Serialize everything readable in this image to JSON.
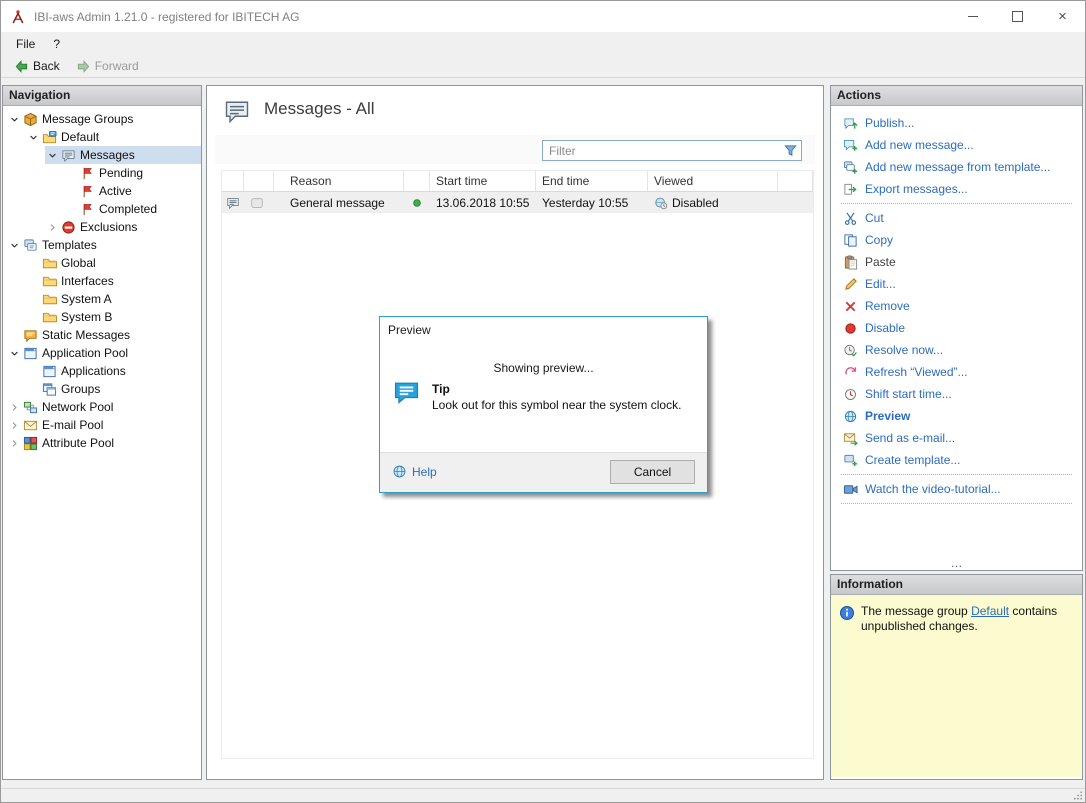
{
  "window": {
    "title": "IBI-aws Admin 1.21.0 - registered for IBITECH AG"
  },
  "menu": {
    "items": [
      {
        "label": "File"
      },
      {
        "label": "?"
      }
    ]
  },
  "toolbar": {
    "back_label": "Back",
    "forward_label": "Forward"
  },
  "navigation": {
    "header": "Navigation",
    "tree": [
      {
        "label": "Message Groups",
        "level": 0,
        "expander": "down",
        "icon": "message-groups-cube"
      },
      {
        "label": "Default",
        "level": 1,
        "expander": "down",
        "icon": "folder-message"
      },
      {
        "label": "Messages",
        "level": 2,
        "expander": "down",
        "icon": "message-bubble",
        "selected": true
      },
      {
        "label": "Pending",
        "level": 3,
        "expander": null,
        "icon": "flag-red"
      },
      {
        "label": "Active",
        "level": 3,
        "expander": null,
        "icon": "flag-red"
      },
      {
        "label": "Completed",
        "level": 3,
        "expander": null,
        "icon": "flag-red"
      },
      {
        "label": "Exclusions",
        "level": 2,
        "expander": "right",
        "icon": "no-entry"
      },
      {
        "label": "Templates",
        "level": 0,
        "expander": "down",
        "icon": "templates-stack"
      },
      {
        "label": "Global",
        "level": 1,
        "expander": null,
        "icon": "folder"
      },
      {
        "label": "Interfaces",
        "level": 1,
        "expander": null,
        "icon": "folder"
      },
      {
        "label": "System A",
        "level": 1,
        "expander": null,
        "icon": "folder"
      },
      {
        "label": "System B",
        "level": 1,
        "expander": null,
        "icon": "folder"
      },
      {
        "label": "Static Messages",
        "level": 0,
        "expander": null,
        "icon": "static-message"
      },
      {
        "label": "Application Pool",
        "level": 0,
        "expander": "down",
        "icon": "app-window"
      },
      {
        "label": "Applications",
        "level": 1,
        "expander": null,
        "icon": "app-window"
      },
      {
        "label": "Groups",
        "level": 1,
        "expander": null,
        "icon": "groups"
      },
      {
        "label": "Network Pool",
        "level": 0,
        "expander": "right",
        "icon": "network"
      },
      {
        "label": "E-mail Pool",
        "level": 0,
        "expander": "right",
        "icon": "envelope"
      },
      {
        "label": "Attribute Pool",
        "level": 0,
        "expander": "right",
        "icon": "attribute-grid"
      }
    ]
  },
  "content": {
    "title": "Messages - All",
    "filter_placeholder": "Filter",
    "table": {
      "columns": [
        "",
        "",
        "Reason",
        "",
        "Start time",
        "End time",
        "Viewed",
        ""
      ],
      "rows": [
        {
          "icon": "message-bubble",
          "badge": "gray-box",
          "reason": "General message",
          "status_icon": "green-dot",
          "start_time": "13.06.2018 10:55",
          "end_time": "Yesterday 10:55",
          "viewed_icon": "viewed-globe-clock",
          "viewed": "Disabled"
        }
      ]
    }
  },
  "dialog": {
    "title": "Preview",
    "message": "Showing preview...",
    "tip_title": "Tip",
    "tip_text": "Look out for this symbol near the system clock.",
    "help_label": "Help",
    "cancel_label": "Cancel"
  },
  "actions": {
    "header": "Actions",
    "more_indicator": "…",
    "items": [
      {
        "label": "Publish...",
        "icon": "publish"
      },
      {
        "label": "Add new message...",
        "icon": "add-message"
      },
      {
        "label": "Add new message from template...",
        "icon": "add-from-template"
      },
      {
        "label": "Export messages...",
        "icon": "export"
      },
      {
        "divider": true
      },
      {
        "label": "Cut",
        "icon": "cut"
      },
      {
        "label": "Copy",
        "icon": "copy"
      },
      {
        "label": "Paste",
        "icon": "paste",
        "state": "disabled"
      },
      {
        "label": "Edit...",
        "icon": "edit-pencil"
      },
      {
        "label": "Remove",
        "icon": "remove-x"
      },
      {
        "label": "Disable",
        "icon": "red-dot"
      },
      {
        "label": "Resolve now...",
        "icon": "resolve-clock"
      },
      {
        "label": "Refresh “Viewed”...",
        "icon": "refresh"
      },
      {
        "label": "Shift start time...",
        "icon": "shift-clock"
      },
      {
        "label": "Preview",
        "icon": "globe",
        "state": "bold"
      },
      {
        "label": "Send as e-mail...",
        "icon": "send-email"
      },
      {
        "label": "Create template...",
        "icon": "create-template"
      },
      {
        "divider": true
      },
      {
        "label": "Watch the video-tutorial...",
        "icon": "video"
      },
      {
        "divider": true
      }
    ]
  },
  "information": {
    "header": "Information",
    "prefix": "The message group ",
    "link": "Default",
    "suffix": " contains unpublished changes."
  },
  "colors": {
    "link_blue": "#2b6cbf",
    "selection": "#cfdeef",
    "info_background": "#fbfbcf",
    "dialog_border": "#2f9cc9",
    "row_background": "#efefef",
    "status_green": "#3fae49",
    "status_red": "#e03b30"
  }
}
